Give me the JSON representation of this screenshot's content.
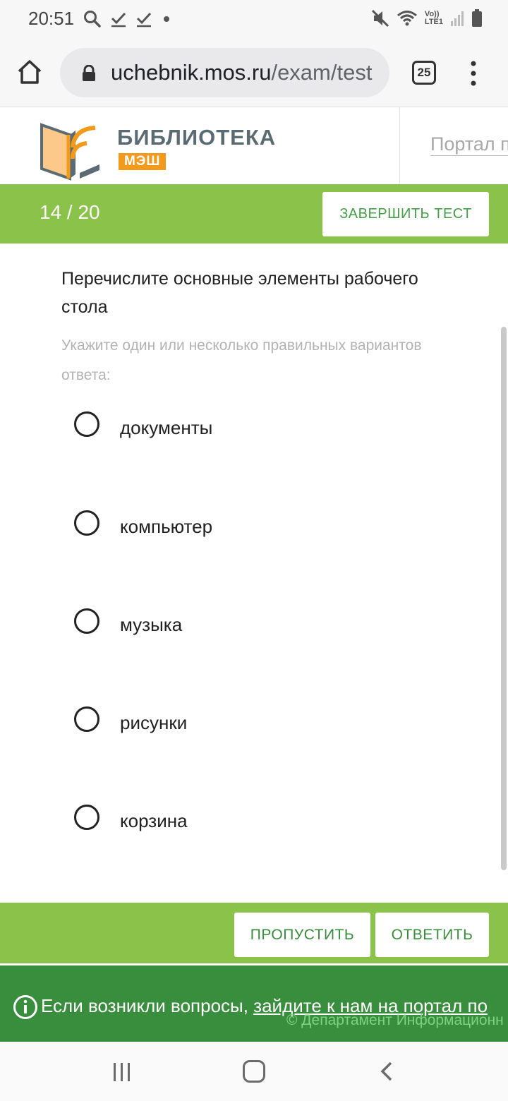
{
  "status_bar": {
    "time": "20:51",
    "lte_top": "Vo))",
    "lte_bottom": "LTE1"
  },
  "browser": {
    "url_host": "uchebnik.mos.ru",
    "url_path": "/exam/test",
    "tab_count": "25"
  },
  "header": {
    "brand_title": "БИБЛИОТЕКА",
    "brand_badge": "МЭШ",
    "portal_link": "Портал п"
  },
  "test_bar": {
    "progress": "14 / 20",
    "finish_label": "ЗАВЕРШИТЬ ТЕСТ"
  },
  "question": {
    "text": "Перечислите основные элементы рабочего стола",
    "hint": "Укажите один или несколько правильных вариантов ответа:",
    "options": [
      {
        "label": "документы"
      },
      {
        "label": "компьютер"
      },
      {
        "label": "музыка"
      },
      {
        "label": "рисунки"
      },
      {
        "label": "корзина"
      }
    ]
  },
  "answer_bar": {
    "skip_label": "ПРОПУСТИТЬ",
    "answer_label": "ОТВЕТИТЬ"
  },
  "footer": {
    "text": "Если возникли вопросы, ",
    "link": "зайдите к нам на портал по",
    "copyright": "© Департамент Информационн"
  },
  "colors": {
    "green_light": "#8bc34a",
    "green_dark": "#388e3c",
    "orange": "#f39a1b"
  }
}
